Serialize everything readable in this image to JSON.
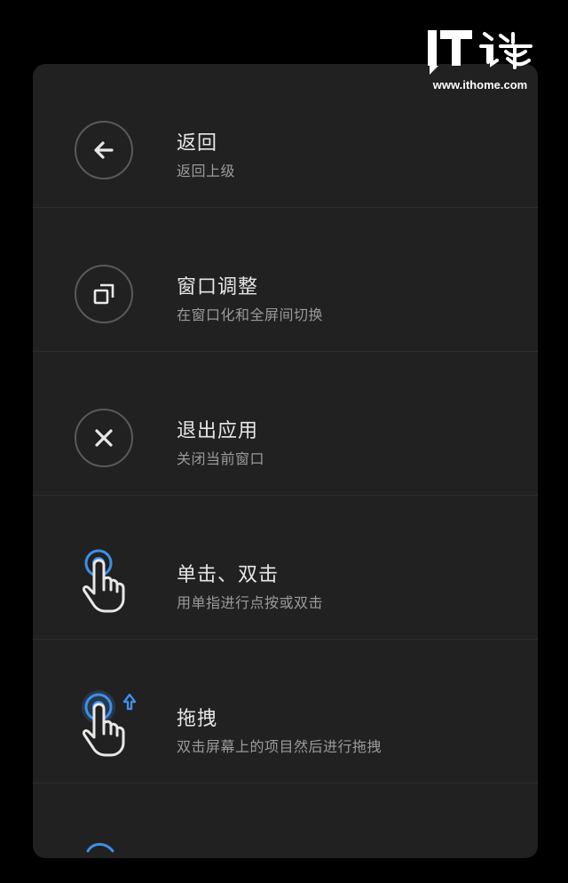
{
  "watermark": {
    "logo_text": "IT之家",
    "url": "www.ithome.com"
  },
  "menu": {
    "items": [
      {
        "title": "返回",
        "subtitle": "返回上级",
        "icon": "back-arrow-icon"
      },
      {
        "title": "窗口调整",
        "subtitle": "在窗口化和全屏间切换",
        "icon": "window-resize-icon"
      },
      {
        "title": "退出应用",
        "subtitle": "关闭当前窗口",
        "icon": "close-icon"
      },
      {
        "title": "单击、双击",
        "subtitle": "用单指进行点按或双击",
        "icon": "tap-gesture-icon"
      },
      {
        "title": "拖拽",
        "subtitle": "双击屏幕上的项目然后进行拖拽",
        "icon": "drag-gesture-icon"
      },
      {
        "title": "",
        "subtitle": "",
        "icon": "gesture-icon"
      }
    ]
  },
  "colors": {
    "background": "#000000",
    "panel": "#212121",
    "accent_blue": "#3d8fe8",
    "icon_ring": "#5a5a5a",
    "title_text": "#e6e6e6",
    "subtitle_text": "#9a9a9a"
  }
}
